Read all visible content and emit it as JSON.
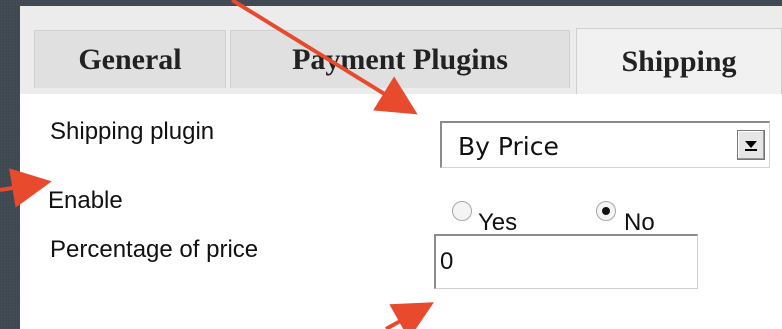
{
  "tabs": [
    {
      "label": "General"
    },
    {
      "label": "Payment Plugins"
    },
    {
      "label": "Shipping"
    }
  ],
  "form": {
    "shipping_plugin_label": "Shipping plugin",
    "shipping_plugin_value": "By Price",
    "enable_label": "Enable",
    "enable_yes": "Yes",
    "enable_no": "No",
    "enable_selected": "No",
    "percentage_label": "Percentage of price",
    "percentage_value": "0"
  },
  "colors": {
    "arrow": "#e84a2d",
    "background": "#3e4650"
  },
  "icons": [
    "dropdown-arrow-icon",
    "annotation-arrow-icon"
  ]
}
